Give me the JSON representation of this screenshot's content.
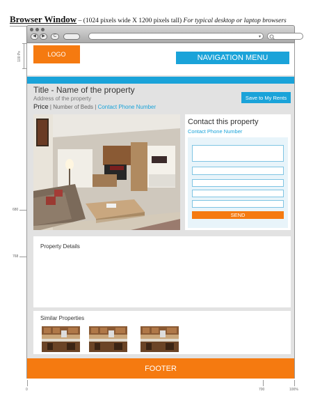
{
  "heading": {
    "title": "Browser Window",
    "dash": " – ",
    "size": "(1024 pixels wide X 1200 pixels tall)",
    "note": "For typical desktop or laptop browsers"
  },
  "browser": {
    "back": "◀",
    "forward": "▶",
    "reload": "C",
    "url_go": "▾",
    "search_icon": "search-icon"
  },
  "header": {
    "logo": "LOGO",
    "nav": "NAVIGATION MENU"
  },
  "property": {
    "title": "Title - Name of the property",
    "address": "Address of the property",
    "price": "Price",
    "beds": "Number of Beds",
    "phone": "Contact Phone Number",
    "separator": "|",
    "save": "Save to My Rents"
  },
  "contact": {
    "title": "Contact this property",
    "phone": "Contact Phone Number",
    "send": "SEND"
  },
  "details": {
    "label": "Property Details"
  },
  "similar": {
    "label": "Similar Properties"
  },
  "footer": {
    "label": "FOOTER"
  },
  "annotations": {
    "header_height": "100 Px",
    "mark_1": "680",
    "mark_2": "768",
    "bottom_0": "0",
    "bottom_1": "700",
    "bottom_2": "100%"
  },
  "colors": {
    "accent_orange": "#f57a10",
    "accent_blue": "#1aa3d9",
    "page_bg": "#e2e2e2"
  }
}
